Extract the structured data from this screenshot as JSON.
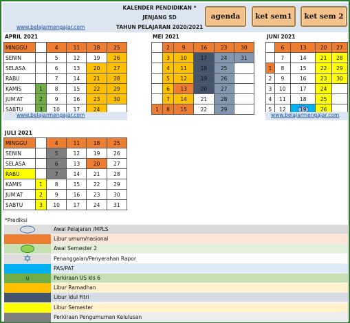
{
  "header": {
    "title_line1": "KALENDER PENDIDIKAN *",
    "title_line2": "JENJANG SD",
    "title_line3": "TAHUN PELAJARAN 2020/2021",
    "website": "www.belajarmengajar.com"
  },
  "buttons": {
    "agenda": "agenda",
    "ket_sem1": "ket sem1",
    "ket_sem2": "ket sem 2"
  },
  "day_labels": [
    "MINGGU",
    "SENIN",
    "SELASA",
    "RABU",
    "KAMIS",
    "JUM'AT",
    "SABTU"
  ],
  "months": {
    "april": {
      "name": "APRIL 2021",
      "rows": [
        [
          "",
          "4",
          "11",
          "18",
          "25"
        ],
        [
          "",
          "5",
          "12",
          "19",
          "26"
        ],
        [
          "",
          "6",
          "13",
          "20",
          "27"
        ],
        [
          "",
          "7",
          "14",
          "21",
          "28"
        ],
        [
          "1",
          "8",
          "15",
          "22",
          "29"
        ],
        [
          "2",
          "9",
          "16",
          "23",
          "30"
        ],
        [
          "3",
          "10",
          "17",
          "24",
          ""
        ]
      ]
    },
    "mei": {
      "name": "MEI 2021",
      "rows": [
        [
          "",
          "2",
          "9",
          "16",
          "23",
          "30"
        ],
        [
          "",
          "3",
          "10",
          "17",
          "24",
          "31"
        ],
        [
          "",
          "4",
          "11",
          "18",
          "25",
          ""
        ],
        [
          "",
          "5",
          "12",
          "19",
          "26",
          ""
        ],
        [
          "",
          "6",
          "13",
          "20",
          "27",
          ""
        ],
        [
          "",
          "7",
          "14",
          "21",
          "28",
          ""
        ],
        [
          "1",
          "8",
          "15",
          "22",
          "29",
          ""
        ]
      ]
    },
    "juni": {
      "name": "JUNI 2021",
      "rows": [
        [
          "",
          "6",
          "13",
          "20",
          "27"
        ],
        [
          "",
          "7",
          "14",
          "21",
          "28"
        ],
        [
          "1",
          "8",
          "15",
          "22",
          "29"
        ],
        [
          "2",
          "9",
          "16",
          "23",
          "30"
        ],
        [
          "3",
          "10",
          "17",
          "24",
          ""
        ],
        [
          "4",
          "11",
          "18",
          "25",
          ""
        ],
        [
          "5",
          "12",
          "19",
          "26",
          ""
        ]
      ]
    },
    "juli": {
      "name": "JULI 2021",
      "rows": [
        [
          "",
          "4",
          "11",
          "18",
          "25"
        ],
        [
          "",
          "5",
          "12",
          "19",
          "26"
        ],
        [
          "",
          "6",
          "13",
          "20",
          "27"
        ],
        [
          "",
          "7",
          "14",
          "21",
          "28"
        ],
        [
          "1",
          "8",
          "15",
          "22",
          "29"
        ],
        [
          "2",
          "9",
          "16",
          "23",
          "30"
        ],
        [
          "3",
          "10",
          "17",
          "24",
          "31"
        ]
      ]
    }
  },
  "colors": {
    "libur_umum": "#ed7d31",
    "ramadhan": "#ffc000",
    "idul_fitri": "#44546a",
    "semester": "#ffff00",
    "kelulusan": "#7f7f7f",
    "us_kls6": "#70ad47",
    "pas": "#00b0f0",
    "mei_ied": "#8497b0"
  },
  "legend": {
    "title": "*Prediksi",
    "items": [
      {
        "label": "Awal Pelajaran /MPLS",
        "icon": "blue-oval-icon"
      },
      {
        "label": "Libur umum/nasional",
        "icon": ""
      },
      {
        "label": "Awal Semester 2",
        "icon": "green-oval-icon"
      },
      {
        "label": "Penanggalan/Penyerahan Rapor",
        "icon": "star-icon"
      },
      {
        "label": "PAS/PAT",
        "icon": ""
      },
      {
        "label": "Perkiraan US kls 6",
        "icon": "",
        "mark": "u"
      },
      {
        "label": "Libur Ramadhan",
        "icon": ""
      },
      {
        "label": "Libur Idul Fitri",
        "icon": ""
      },
      {
        "label": "Libur Semester",
        "icon": ""
      },
      {
        "label": "Perkiraan Pengumuman Kelulusan",
        "icon": ""
      }
    ]
  }
}
